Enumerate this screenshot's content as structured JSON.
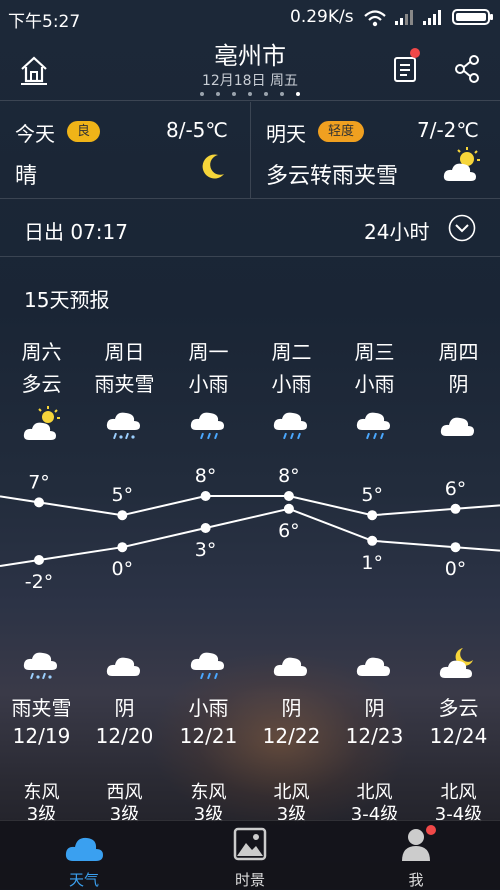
{
  "status": {
    "time": "下午5:27",
    "net_speed": "0.29K/s"
  },
  "header": {
    "city": "亳州市",
    "date": "12月18日 周五",
    "pages": 7,
    "active_page": 6
  },
  "today": {
    "label": "今天",
    "aqi": "良",
    "temp": "8/-5℃",
    "condition": "晴",
    "icon": "moon-icon"
  },
  "tomorrow": {
    "label": "明天",
    "aqi": "轻度",
    "temp": "7/-2℃",
    "condition": "多云转雨夹雪",
    "icon": "partly-cloudy-icon"
  },
  "sun": {
    "sunrise": "日出 07:17",
    "hours_label": "24小时"
  },
  "forecast_title": "15天预报",
  "days": [
    {
      "day": "周六",
      "day_cond": "多云",
      "day_icon": "partly-cloudy-icon",
      "high": "7°",
      "low": "-2°",
      "night_icon": "sleet-icon",
      "night_cond": "雨夹雪",
      "date": "12/19",
      "wind": "东风",
      "level": "3级"
    },
    {
      "day": "周日",
      "day_cond": "雨夹雪",
      "day_icon": "sleet-icon",
      "high": "5°",
      "low": "0°",
      "night_icon": "cloudy-icon",
      "night_cond": "阴",
      "date": "12/20",
      "wind": "西风",
      "level": "3级"
    },
    {
      "day": "周一",
      "day_cond": "小雨",
      "day_icon": "rain-icon",
      "high": "8°",
      "low": "3°",
      "night_icon": "rain-icon",
      "night_cond": "小雨",
      "date": "12/21",
      "wind": "东风",
      "level": "3级"
    },
    {
      "day": "周二",
      "day_cond": "小雨",
      "day_icon": "rain-icon",
      "high": "8°",
      "low": "6°",
      "night_icon": "cloudy-icon",
      "night_cond": "阴",
      "date": "12/22",
      "wind": "北风",
      "level": "3级"
    },
    {
      "day": "周三",
      "day_cond": "小雨",
      "day_icon": "rain-icon",
      "high": "5°",
      "low": "1°",
      "night_icon": "cloudy-icon",
      "night_cond": "阴",
      "date": "12/23",
      "wind": "北风",
      "level": "3-4级"
    },
    {
      "day": "周四",
      "day_cond": "阴",
      "day_icon": "cloudy-icon",
      "high": "6°",
      "low": "0°",
      "night_icon": "cloudy-moon-icon",
      "night_cond": "多云",
      "date": "12/24",
      "wind": "北风",
      "level": "3-4级"
    }
  ],
  "chart_data": {
    "type": "line",
    "categories": [
      "12/19",
      "12/20",
      "12/21",
      "12/22",
      "12/23",
      "12/24"
    ],
    "series": [
      {
        "values": [
          7,
          5,
          8,
          8,
          5,
          6
        ]
      },
      {
        "values": [
          -2,
          0,
          3,
          6,
          1,
          0
        ]
      }
    ]
  },
  "tabs": [
    {
      "label": "天气",
      "icon": "cloud-icon",
      "active": true
    },
    {
      "label": "时景",
      "icon": "photo-icon",
      "active": false
    },
    {
      "label": "我",
      "icon": "user-icon",
      "active": false
    }
  ],
  "colors": {
    "accent": "#3aa0f0",
    "aqi_good": "#f0b418",
    "aqi_light": "#f0a020",
    "badge": "#f04848"
  }
}
